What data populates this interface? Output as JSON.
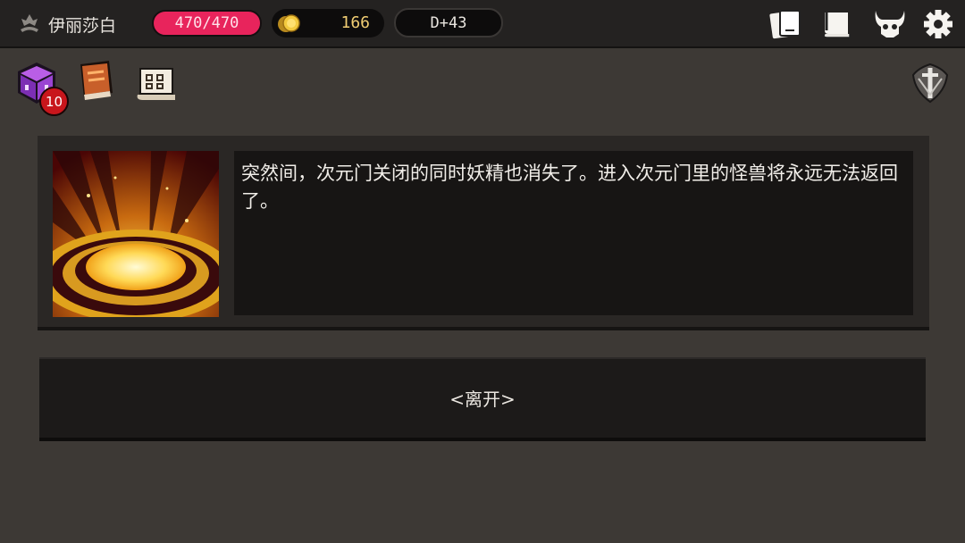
{
  "topbar": {
    "player_name": "伊丽莎白",
    "hp": "470/470",
    "gold": "166",
    "day": "D+43",
    "icons": [
      "class-emblem-icon",
      "gold-coin-icon",
      "cards-icon",
      "scroll-map-icon",
      "demon-skull-icon",
      "gear-icon"
    ]
  },
  "inventory": {
    "items": [
      "purple-cube-icon",
      "spellbook-icon",
      "rune-scroll-icon"
    ],
    "cube_count": "10"
  },
  "event": {
    "image": "glowing-portal-image",
    "text": "突然间，次元门关闭的同时妖精也消失了。进入次元门里的怪兽将永远无法返回了。"
  },
  "choices": [
    {
      "label": "<离开>"
    }
  ],
  "colors": {
    "hp_pill": "#e8245c",
    "gold_text": "#f0cd73",
    "background": "#3d3935",
    "panel": "#2a2725"
  }
}
